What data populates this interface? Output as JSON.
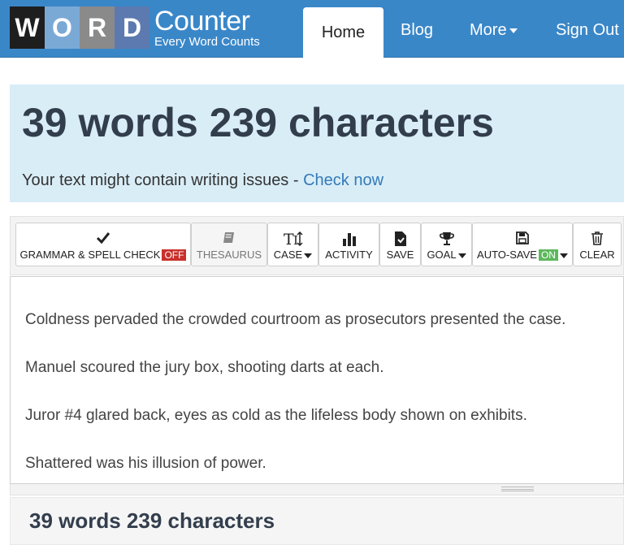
{
  "brand": {
    "letters": [
      "W",
      "O",
      "R",
      "D"
    ],
    "name": "Counter",
    "tagline": "Every Word Counts"
  },
  "nav": {
    "home": "Home",
    "blog": "Blog",
    "more": "More",
    "signout": "Sign Out"
  },
  "hero": {
    "title": "39 words 239 characters",
    "sub_text": "Your text might contain writing issues - ",
    "sub_link": "Check now"
  },
  "toolbar": {
    "grammar": "GRAMMAR & SPELL CHECK",
    "grammar_state": "OFF",
    "thesaurus": "THESAURUS",
    "case": "CASE",
    "activity": "ACTIVITY",
    "save": "SAVE",
    "goal": "GOAL",
    "autosave": "AUTO-SAVE",
    "autosave_state": "ON",
    "clear": "CLEAR"
  },
  "editor": {
    "lines": [
      "Coldness pervaded the crowded courtroom as prosecutors presented the case.",
      "Manuel scoured the jury box, shooting darts at each.",
      "Juror #4 glared back, eyes as cold as the lifeless body shown on exhibits.",
      "Shattered was his illusion of power."
    ]
  },
  "summary": {
    "count": "39 words 239 characters"
  },
  "colors": {
    "navbar": "#3a87c8",
    "hero_bg": "#d9edf7",
    "link": "#337ab7",
    "off_badge": "#c9302c",
    "on_badge": "#5cb85c"
  }
}
